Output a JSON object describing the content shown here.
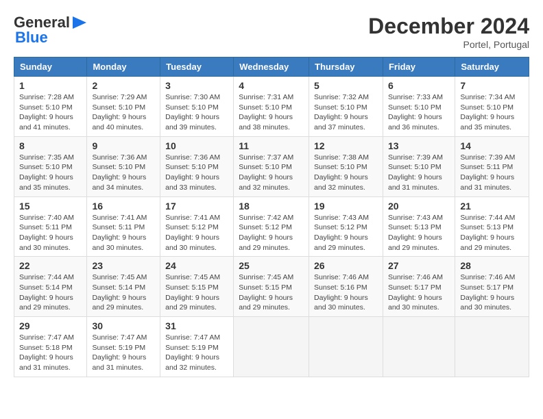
{
  "header": {
    "logo_general": "General",
    "logo_blue": "Blue",
    "month_title": "December 2024",
    "location": "Portel, Portugal"
  },
  "days_of_week": [
    "Sunday",
    "Monday",
    "Tuesday",
    "Wednesday",
    "Thursday",
    "Friday",
    "Saturday"
  ],
  "weeks": [
    [
      {
        "day": "1",
        "sunrise": "7:28 AM",
        "sunset": "5:10 PM",
        "daylight_hours": "9",
        "daylight_minutes": "41"
      },
      {
        "day": "2",
        "sunrise": "7:29 AM",
        "sunset": "5:10 PM",
        "daylight_hours": "9",
        "daylight_minutes": "40"
      },
      {
        "day": "3",
        "sunrise": "7:30 AM",
        "sunset": "5:10 PM",
        "daylight_hours": "9",
        "daylight_minutes": "39"
      },
      {
        "day": "4",
        "sunrise": "7:31 AM",
        "sunset": "5:10 PM",
        "daylight_hours": "9",
        "daylight_minutes": "38"
      },
      {
        "day": "5",
        "sunrise": "7:32 AM",
        "sunset": "5:10 PM",
        "daylight_hours": "9",
        "daylight_minutes": "37"
      },
      {
        "day": "6",
        "sunrise": "7:33 AM",
        "sunset": "5:10 PM",
        "daylight_hours": "9",
        "daylight_minutes": "36"
      },
      {
        "day": "7",
        "sunrise": "7:34 AM",
        "sunset": "5:10 PM",
        "daylight_hours": "9",
        "daylight_minutes": "35"
      }
    ],
    [
      {
        "day": "8",
        "sunrise": "7:35 AM",
        "sunset": "5:10 PM",
        "daylight_hours": "9",
        "daylight_minutes": "35"
      },
      {
        "day": "9",
        "sunrise": "7:36 AM",
        "sunset": "5:10 PM",
        "daylight_hours": "9",
        "daylight_minutes": "34"
      },
      {
        "day": "10",
        "sunrise": "7:36 AM",
        "sunset": "5:10 PM",
        "daylight_hours": "9",
        "daylight_minutes": "33"
      },
      {
        "day": "11",
        "sunrise": "7:37 AM",
        "sunset": "5:10 PM",
        "daylight_hours": "9",
        "daylight_minutes": "32"
      },
      {
        "day": "12",
        "sunrise": "7:38 AM",
        "sunset": "5:10 PM",
        "daylight_hours": "9",
        "daylight_minutes": "32"
      },
      {
        "day": "13",
        "sunrise": "7:39 AM",
        "sunset": "5:10 PM",
        "daylight_hours": "9",
        "daylight_minutes": "31"
      },
      {
        "day": "14",
        "sunrise": "7:39 AM",
        "sunset": "5:11 PM",
        "daylight_hours": "9",
        "daylight_minutes": "31"
      }
    ],
    [
      {
        "day": "15",
        "sunrise": "7:40 AM",
        "sunset": "5:11 PM",
        "daylight_hours": "9",
        "daylight_minutes": "30"
      },
      {
        "day": "16",
        "sunrise": "7:41 AM",
        "sunset": "5:11 PM",
        "daylight_hours": "9",
        "daylight_minutes": "30"
      },
      {
        "day": "17",
        "sunrise": "7:41 AM",
        "sunset": "5:12 PM",
        "daylight_hours": "9",
        "daylight_minutes": "30"
      },
      {
        "day": "18",
        "sunrise": "7:42 AM",
        "sunset": "5:12 PM",
        "daylight_hours": "9",
        "daylight_minutes": "29"
      },
      {
        "day": "19",
        "sunrise": "7:43 AM",
        "sunset": "5:12 PM",
        "daylight_hours": "9",
        "daylight_minutes": "29"
      },
      {
        "day": "20",
        "sunrise": "7:43 AM",
        "sunset": "5:13 PM",
        "daylight_hours": "9",
        "daylight_minutes": "29"
      },
      {
        "day": "21",
        "sunrise": "7:44 AM",
        "sunset": "5:13 PM",
        "daylight_hours": "9",
        "daylight_minutes": "29"
      }
    ],
    [
      {
        "day": "22",
        "sunrise": "7:44 AM",
        "sunset": "5:14 PM",
        "daylight_hours": "9",
        "daylight_minutes": "29"
      },
      {
        "day": "23",
        "sunrise": "7:45 AM",
        "sunset": "5:14 PM",
        "daylight_hours": "9",
        "daylight_minutes": "29"
      },
      {
        "day": "24",
        "sunrise": "7:45 AM",
        "sunset": "5:15 PM",
        "daylight_hours": "9",
        "daylight_minutes": "29"
      },
      {
        "day": "25",
        "sunrise": "7:45 AM",
        "sunset": "5:15 PM",
        "daylight_hours": "9",
        "daylight_minutes": "29"
      },
      {
        "day": "26",
        "sunrise": "7:46 AM",
        "sunset": "5:16 PM",
        "daylight_hours": "9",
        "daylight_minutes": "30"
      },
      {
        "day": "27",
        "sunrise": "7:46 AM",
        "sunset": "5:17 PM",
        "daylight_hours": "9",
        "daylight_minutes": "30"
      },
      {
        "day": "28",
        "sunrise": "7:46 AM",
        "sunset": "5:17 PM",
        "daylight_hours": "9",
        "daylight_minutes": "30"
      }
    ],
    [
      {
        "day": "29",
        "sunrise": "7:47 AM",
        "sunset": "5:18 PM",
        "daylight_hours": "9",
        "daylight_minutes": "31"
      },
      {
        "day": "30",
        "sunrise": "7:47 AM",
        "sunset": "5:19 PM",
        "daylight_hours": "9",
        "daylight_minutes": "31"
      },
      {
        "day": "31",
        "sunrise": "7:47 AM",
        "sunset": "5:19 PM",
        "daylight_hours": "9",
        "daylight_minutes": "32"
      },
      null,
      null,
      null,
      null
    ]
  ],
  "labels": {
    "sunrise": "Sunrise:",
    "sunset": "Sunset:",
    "daylight": "Daylight:",
    "daylight_suffix": "hours and",
    "minutes_suffix": "minutes."
  }
}
